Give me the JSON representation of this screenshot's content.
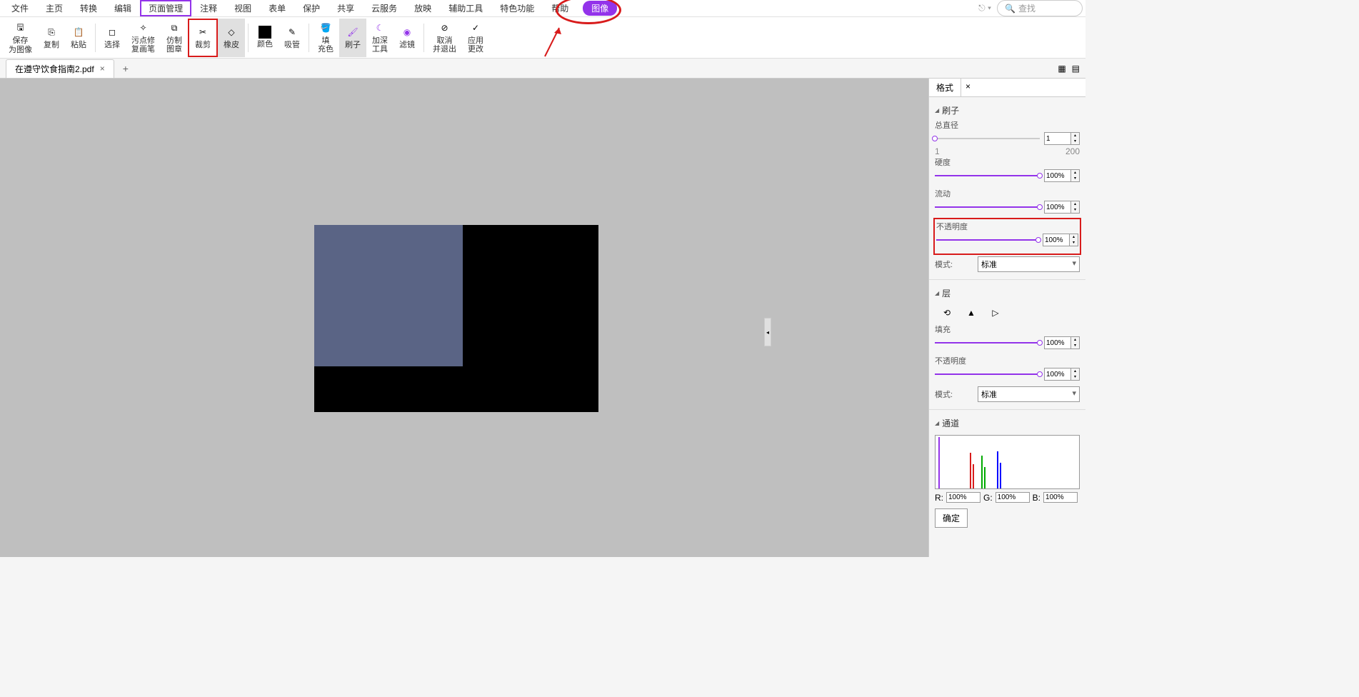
{
  "menu": {
    "items": [
      "文件",
      "主页",
      "转换",
      "编辑",
      "页面管理",
      "注释",
      "视图",
      "表单",
      "保护",
      "共享",
      "云服务",
      "放映",
      "辅助工具",
      "特色功能",
      "帮助"
    ],
    "image_tab": "图像",
    "search_placeholder": "查找"
  },
  "toolbar": {
    "items": [
      {
        "label": "保存\n为图像"
      },
      {
        "label": "复制"
      },
      {
        "label": "粘贴"
      },
      {
        "label": "选择"
      },
      {
        "label": "污点修\n复画笔"
      },
      {
        "label": "仿制\n图章"
      },
      {
        "label": "裁剪"
      },
      {
        "label": "橡皮"
      },
      {
        "label": "颜色"
      },
      {
        "label": "吸管"
      },
      {
        "label": "填\n充色"
      },
      {
        "label": "刷子"
      },
      {
        "label": "加深\n工具"
      },
      {
        "label": "滤镜"
      },
      {
        "label": "取消\n并退出"
      },
      {
        "label": "应用\n更改"
      }
    ]
  },
  "tabs": {
    "doc": "在遵守饮食指南2.pdf"
  },
  "right_panel": {
    "tab": "格式",
    "brush": {
      "title": "刷子",
      "diameter_label": "总直径",
      "diameter_value": "1",
      "diameter_min": "1",
      "diameter_max": "200",
      "hardness_label": "硬度",
      "hardness_value": "100%",
      "flow_label": "流动",
      "flow_value": "100%",
      "opacity_label": "不透明度",
      "opacity_value": "100%",
      "mode_label": "模式:",
      "mode_value": "标准"
    },
    "layer": {
      "title": "层",
      "fill_label": "填充",
      "fill_value": "100%",
      "opacity_label": "不透明度",
      "opacity_value": "100%",
      "mode_label": "模式:",
      "mode_value": "标准"
    },
    "channel": {
      "title": "通道",
      "r_label": "R:",
      "g_label": "G:",
      "b_label": "B:",
      "r_value": "100%",
      "g_value": "100%",
      "b_value": "100%",
      "ok": "确定"
    }
  }
}
